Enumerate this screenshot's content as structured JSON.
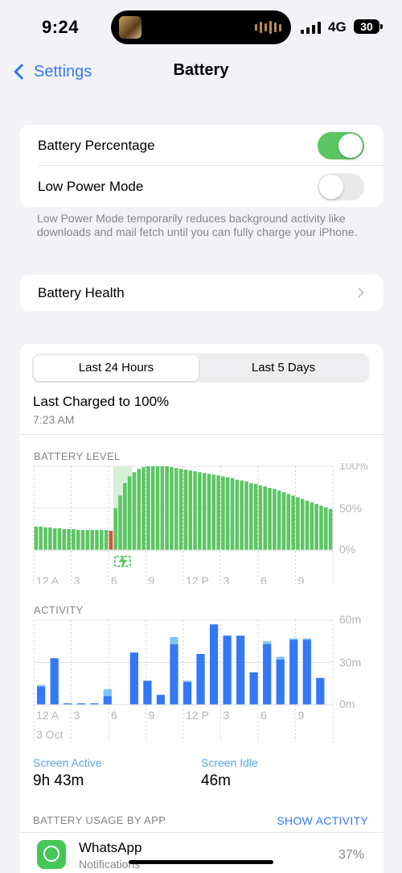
{
  "status_bar": {
    "time": "9:24",
    "network": "4G",
    "battery_percent": "30"
  },
  "nav": {
    "back_label": "Settings",
    "title": "Battery"
  },
  "settings": {
    "battery_percentage": {
      "label": "Battery Percentage",
      "enabled": true
    },
    "low_power_mode": {
      "label": "Low Power Mode",
      "enabled": false
    },
    "footnote": "Low Power Mode temporarily reduces background activity like downloads and mail fetch until you can fully charge your iPhone.",
    "battery_health_label": "Battery Health"
  },
  "usage": {
    "segments": [
      "Last 24 Hours",
      "Last 5 Days"
    ],
    "selected_segment": "Last 24 Hours",
    "last_charged": "Last Charged to 100%",
    "last_charged_time": "7:23 AM",
    "battery_level_label": "BATTERY LEVEL",
    "activity_label": "ACTIVITY",
    "screen_active_label": "Screen Active",
    "screen_active_value": "9h 43m",
    "screen_idle_label": "Screen Idle",
    "screen_idle_value": "46m",
    "battery_usage_label": "BATTERY USAGE BY APP",
    "show_activity_label": "SHOW ACTIVITY"
  },
  "apps": [
    {
      "name": "WhatsApp",
      "subtitle": "Notifications",
      "percent": "37%",
      "icon": "whatsapp-icon"
    }
  ],
  "colors": {
    "accent": "#3478f6",
    "toggle_on": "#5cc564",
    "battery_green": "#5cc564",
    "battery_low_red": "#e5493a",
    "charging_zone": "#d5f0d5",
    "screen_active": "#3478f6",
    "screen_idle": "#7dc4f7"
  },
  "chart_data": [
    {
      "type": "bar",
      "title": "BATTERY LEVEL",
      "x_tick_labels": [
        "12 A",
        "3",
        "6",
        "9",
        "12 P",
        "3",
        "6",
        "9"
      ],
      "y_tick_labels": [
        "100%",
        "50%",
        "0%"
      ],
      "ylim": [
        0,
        100
      ],
      "unit": "%",
      "bar_count": 64,
      "charging_start_index": 17,
      "charging_end_index": 20,
      "low_battery_index": 16,
      "values": [
        28,
        28,
        27,
        27,
        26,
        26,
        25,
        25,
        25,
        24,
        24,
        24,
        24,
        24,
        24,
        24,
        23,
        50,
        65,
        80,
        88,
        93,
        97,
        99,
        100,
        100,
        100,
        100,
        100,
        99,
        98,
        97,
        96,
        95,
        94,
        93,
        92,
        91,
        90,
        89,
        88,
        87,
        86,
        84,
        83,
        82,
        80,
        79,
        77,
        76,
        74,
        73,
        71,
        69,
        67,
        65,
        63,
        61,
        59,
        57,
        55,
        53,
        51,
        49
      ]
    },
    {
      "type": "bar",
      "title": "ACTIVITY",
      "x_tick_labels": [
        "12 A",
        "3",
        "6",
        "9",
        "12 P",
        "3",
        "6",
        "9"
      ],
      "x_date_label": "3 Oct",
      "y_tick_labels": [
        "60m",
        "30m",
        "0m"
      ],
      "ylim": [
        0,
        60
      ],
      "unit": "minutes",
      "series": [
        {
          "name": "Screen Active",
          "values": [
            13,
            33,
            1,
            1,
            1,
            6,
            0,
            37,
            17,
            7,
            43,
            16,
            36,
            57,
            49,
            49,
            23,
            43,
            32,
            46,
            46,
            19
          ]
        },
        {
          "name": "Screen Idle",
          "values": [
            1,
            0,
            0,
            0,
            0,
            5,
            0,
            0,
            0,
            0,
            5,
            1,
            0,
            0,
            0,
            0,
            0,
            2,
            2,
            1,
            1,
            0
          ]
        }
      ]
    }
  ]
}
